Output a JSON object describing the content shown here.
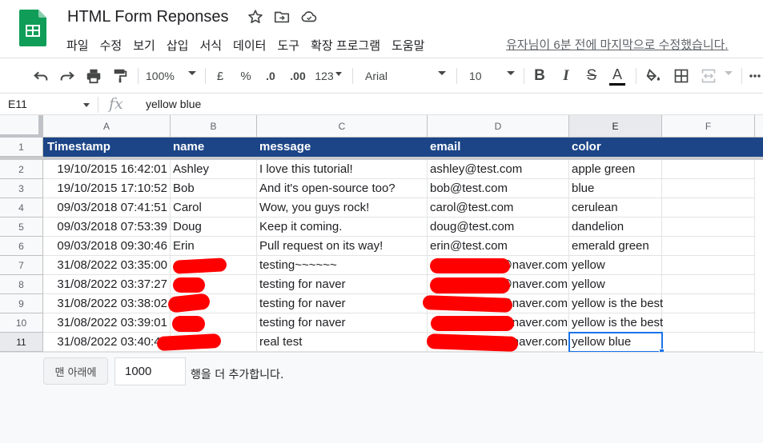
{
  "doc": {
    "title": "HTML Form Reponses"
  },
  "menu": [
    "파일",
    "수정",
    "보기",
    "삽입",
    "서식",
    "데이터",
    "도구",
    "확장 프로그램",
    "도움말"
  ],
  "last_edit": "유자님이 6분 전에 마지막으로 수정했습니다.",
  "toolbar": {
    "zoom": "100%",
    "currency": "£",
    "percent": "%",
    "decimal_decrease": ".0",
    "decimal_increase": ".00",
    "format_more": "123",
    "font": "Arial",
    "font_size": "10",
    "bold": "B",
    "italic": "I",
    "strike": "S",
    "text_color_letter": "A",
    "more": "⋮"
  },
  "formula_bar": {
    "cell_ref": "E11",
    "fx": "fx",
    "value": "yellow blue"
  },
  "columns": [
    "A",
    "B",
    "C",
    "D",
    "E",
    "F"
  ],
  "header_row": {
    "row_number": "1",
    "cells": [
      "Timestamp",
      "name",
      "message",
      "email",
      "color"
    ]
  },
  "rows": [
    {
      "n": "2",
      "timestamp": "19/10/2015 16:42:01",
      "name": "Ashley",
      "message": "I love this tutorial!",
      "email": "ashley@test.com",
      "color": "apple green"
    },
    {
      "n": "3",
      "timestamp": "19/10/2015 17:10:52",
      "name": "Bob",
      "message": "And it's open-source too?",
      "email": "bob@test.com",
      "color": "blue"
    },
    {
      "n": "4",
      "timestamp": "09/03/2018 07:41:51",
      "name": "Carol",
      "message": "Wow, you guys rock!",
      "email": "carol@test.com",
      "color": "cerulean"
    },
    {
      "n": "5",
      "timestamp": "09/03/2018 07:53:39",
      "name": "Doug",
      "message": "Keep it coming.",
      "email": "doug@test.com",
      "color": "dandelion"
    },
    {
      "n": "6",
      "timestamp": "09/03/2018 09:30:46",
      "name": "Erin",
      "message": "Pull request on its way!",
      "email": "erin@test.com",
      "color": "emerald green"
    },
    {
      "n": "7",
      "timestamp": "31/08/2022 03:35:00",
      "name": "",
      "message": "testing~~~~~~",
      "email": "@naver.com",
      "color": "yellow"
    },
    {
      "n": "8",
      "timestamp": "31/08/2022 03:37:27",
      "name": "",
      "message": "testing for naver",
      "email": "@naver.com",
      "color": "yellow"
    },
    {
      "n": "9",
      "timestamp": "31/08/2022 03:38:02",
      "name": "",
      "message": "testing for naver",
      "email": "@naver.com",
      "color": "yellow is the best"
    },
    {
      "n": "10",
      "timestamp": "31/08/2022 03:39:01",
      "name": "",
      "message": "testing for naver",
      "email": "@naver.com",
      "color": "yellow is the best"
    },
    {
      "n": "11",
      "timestamp": "31/08/2022 03:40:46",
      "name": "",
      "message": "real test",
      "email": "@naver.com",
      "color": "yellow blue"
    }
  ],
  "footer": {
    "add_button": "맨 아래에",
    "add_count": "1000",
    "add_label": "행을 더 추가합니다."
  },
  "colors": {
    "header_fill": "#1c4587",
    "selection": "#1a73e8",
    "redaction": "#ff0000"
  }
}
